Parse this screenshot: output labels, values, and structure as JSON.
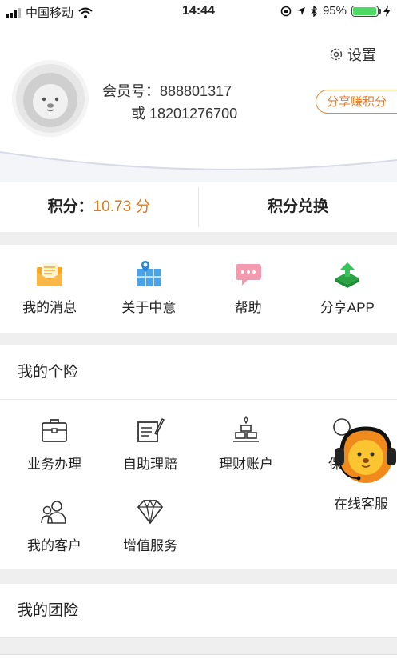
{
  "status_bar": {
    "carrier": "中国移动",
    "time": "14:44",
    "battery_percent": "95%",
    "battery_level": 0.95
  },
  "profile": {
    "settings_label": "设置",
    "member_label": "会员号：888801317",
    "phone_label": "或 18201276700",
    "share_points_label": "分享赚积分"
  },
  "points_bar": {
    "points_prefix": "积分：",
    "points_value": "10.73 分",
    "exchange_label": "积分兑换"
  },
  "quick_actions": [
    {
      "label": "我的消息",
      "icon": "message-envelope-icon"
    },
    {
      "label": "关于中意",
      "icon": "map-pin-icon"
    },
    {
      "label": "帮助",
      "icon": "chat-bubble-icon"
    },
    {
      "label": "分享APP",
      "icon": "share-upload-icon"
    }
  ],
  "personal_insurance": {
    "title": "我的个险",
    "items": [
      {
        "label": "业务办理",
        "icon": "briefcase-icon"
      },
      {
        "label": "自助理赔",
        "icon": "form-pen-icon"
      },
      {
        "label": "理财账户",
        "icon": "gold-bars-icon"
      },
      {
        "label": "保险",
        "icon": "insurance-icon"
      },
      {
        "label": "我的客户",
        "icon": "customers-icon"
      },
      {
        "label": "增值服务",
        "icon": "diamond-icon"
      }
    ]
  },
  "online_service": {
    "label": "在线客服",
    "icon": "lion-headset-icon"
  },
  "group_insurance": {
    "title": "我的团险"
  },
  "colors": {
    "accent": "#e07b1e",
    "share_border": "#e88a3c",
    "battery": "#4cd964"
  }
}
